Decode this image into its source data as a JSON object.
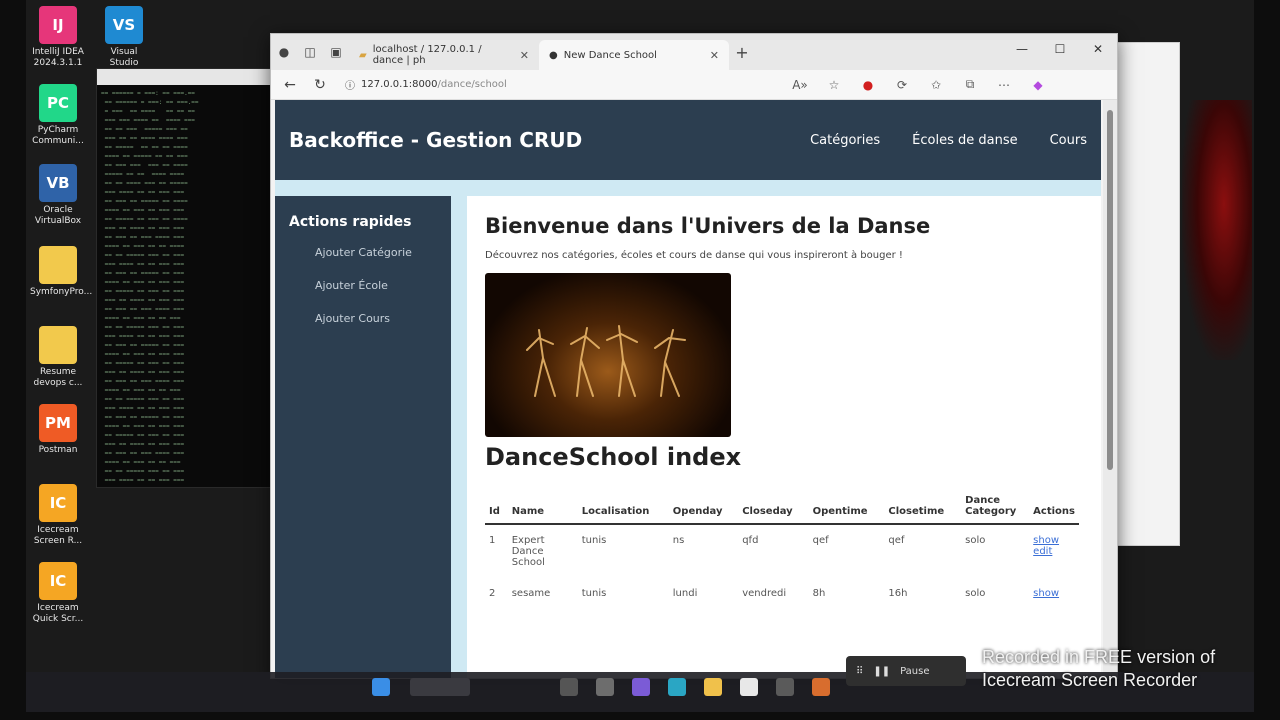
{
  "desktop": {
    "icons": [
      {
        "label": "IntelliJ IDEA 2024.3.1.1",
        "glyph": "IJ",
        "color": "#e6367a"
      },
      {
        "label": "Visual Studio",
        "glyph": "VS",
        "color": "#1f8ad2"
      },
      {
        "label": "PyCharm Communi...",
        "glyph": "PC",
        "color": "#21d789"
      },
      {
        "label": "Oracle VirtualBox",
        "glyph": "VB",
        "color": "#2f63a8"
      },
      {
        "label": "SymfonyPro...",
        "glyph": "",
        "color": "#f2c94c"
      },
      {
        "label": "Resume devops c...",
        "glyph": "",
        "color": "#f2c94c"
      },
      {
        "label": "Postman",
        "glyph": "PM",
        "color": "#ef5b25"
      },
      {
        "label": "Icecream Screen R...",
        "glyph": "IC",
        "color": "#f5a623"
      },
      {
        "label": "Icecream Quick Scr...",
        "glyph": "IC",
        "color": "#f5a623"
      }
    ]
  },
  "browser": {
    "tabs": [
      {
        "label": "localhost / 127.0.0.1 / dance | ph"
      },
      {
        "label": "New Dance School"
      }
    ],
    "address": {
      "host": "127.0.0.1:8000",
      "path": "/dance/school"
    }
  },
  "site": {
    "brand": "Backoffice - Gestion CRUD",
    "nav": [
      "Catégories",
      "Écoles de danse",
      "Cours"
    ],
    "sidebar": {
      "title": "Actions rapides",
      "links": [
        "Ajouter Catégorie",
        "Ajouter École",
        "Ajouter Cours"
      ]
    },
    "welcome_title": "Bienvenue dans l'Univers de la Danse",
    "welcome_sub": "Découvrez nos catégories, écoles et cours de danse qui vous inspireront à bouger !",
    "index_title": "DanceSchool index",
    "table": {
      "headers": [
        "Id",
        "Name",
        "Localisation",
        "Openday",
        "Closeday",
        "Opentime",
        "Closetime",
        "Dance Category",
        "Actions"
      ],
      "rows": [
        [
          "1",
          "Expert Dance School",
          "tunis",
          "ns",
          "qfd",
          "qef",
          "qef",
          "solo",
          "show edit"
        ],
        [
          "2",
          "sesame",
          "tunis",
          "lundi",
          "vendredi",
          "8h",
          "16h",
          "solo",
          "show"
        ]
      ]
    }
  },
  "recorder": {
    "pause": "Pause",
    "watermark_line1": "Recorded in FREE version of",
    "watermark_line2": "Icecream  Screen  Recorder"
  }
}
